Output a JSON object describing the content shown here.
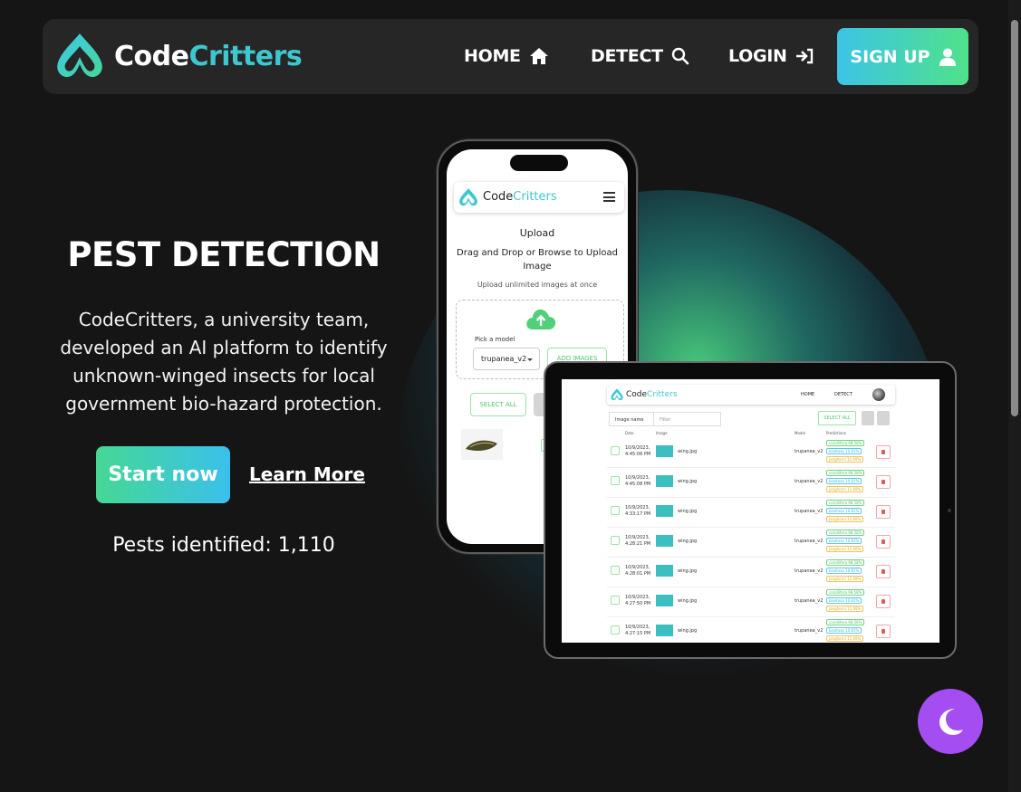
{
  "navbar": {
    "brand_part1": "Code",
    "brand_part2": "Critters",
    "home": "HOME",
    "detect": "DETECT",
    "login": "LOGIN",
    "signup": "SIGN UP"
  },
  "hero": {
    "title": "PEST DETECTION",
    "description": "CodeCritters, a university team, developed an AI platform to identify unknown-winged insects for local government bio-hazard protection.",
    "start_button": "Start now",
    "learn_more": "Learn More",
    "pests_label": "Pests identified: 1,110"
  },
  "phone": {
    "brand_part1": "Code",
    "brand_part2": "Critters",
    "upload_title": "Upload",
    "drag_text": "Drag and Drop or Browse to Upload Image",
    "unlimited": "Upload unlimited images at once",
    "pick_model": "Pick a model",
    "model_value": "trupanea_v2",
    "add_images": "ADD IMAGES",
    "select_all": "SELECT ALL"
  },
  "tablet": {
    "brand_part1": "Code",
    "brand_part2": "Critters",
    "home": "HOME",
    "detect": "DETECT",
    "filter_select": "Image name",
    "filter_placeholder": "Filter",
    "select_all": "SELECT ALL",
    "headers": {
      "date": "Date",
      "image": "Image",
      "model": "Model",
      "predictions": "Predictions"
    },
    "rows": [
      {
        "date": "10/9/2023, 4:45:06 PM",
        "file": "wing.jpg",
        "model": "trupanea_v2",
        "p1": "corollifera 98.58%",
        "p2": "bisetosa 10.81%",
        "p3": "jonghorni 11.69%"
      },
      {
        "date": "10/9/2023, 4:45:08 PM",
        "file": "wing.jpg",
        "model": "trupanea_v2",
        "p1": "corollifera 98.58%",
        "p2": "bisetosa 10.81%",
        "p3": "jonghorni 11.69%"
      },
      {
        "date": "10/9/2023, 4:33:17 PM",
        "file": "wing.jpg",
        "model": "trupanea_v2",
        "p1": "corollifera 98.58%",
        "p2": "bisetosa 10.81%",
        "p3": "jonghorni 11.69%"
      },
      {
        "date": "10/9/2023, 4:28:21 PM",
        "file": "wing.jpg",
        "model": "trupanea_v2",
        "p1": "corollifera 98.58%",
        "p2": "bisetosa 10.81%",
        "p3": "jonghorni 11.69%"
      },
      {
        "date": "10/9/2023, 4:28:01 PM",
        "file": "wing.jpg",
        "model": "trupanea_v2",
        "p1": "corollifera 98.58%",
        "p2": "bisetosa 10.81%",
        "p3": "jonghorni 11.69%"
      },
      {
        "date": "10/9/2023, 4:27:50 PM",
        "file": "wing.jpg",
        "model": "trupanea_v2",
        "p1": "corollifera 98.58%",
        "p2": "bisetosa 10.81%",
        "p3": "jonghorni 11.69%"
      },
      {
        "date": "10/9/2023, 4:27:15 PM",
        "file": "wing.jpg",
        "model": "trupanea_v2",
        "p1": "corollifera 98.58%",
        "p2": "bisetosa 10.81%",
        "p3": "jonghorni 11.69%"
      }
    ]
  },
  "icons": {
    "home": "home-icon",
    "detect": "search-icon",
    "login": "login-icon",
    "signup": "user-icon",
    "theme": "moon-icon",
    "upload": "cloud-upload-icon"
  },
  "colors": {
    "accent_teal": "#3ec7cf",
    "accent_green": "#4fe28a",
    "toggle_purple": "#a44ef2",
    "background": "#151515"
  }
}
